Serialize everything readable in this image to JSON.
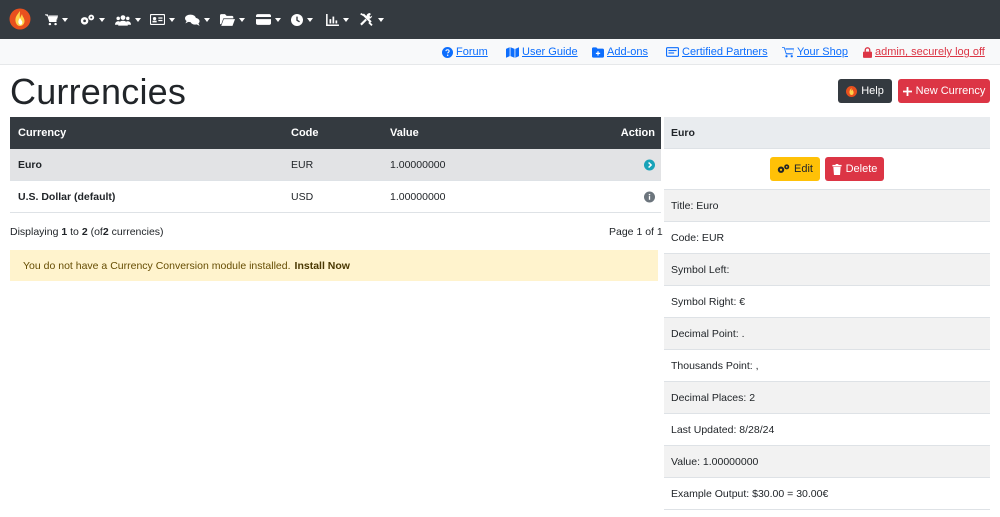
{
  "nav": {
    "icons": [
      "cart-icon",
      "gears-icon",
      "users-icon",
      "id-card-icon",
      "comments-icon",
      "folder-icon",
      "credit-card-icon",
      "clock-icon",
      "chart-icon",
      "tools-icon"
    ]
  },
  "links": {
    "forum": "Forum",
    "user_guide": "User Guide",
    "addons": "Add-ons",
    "partners": "Certified Partners",
    "shop": "Your Shop",
    "logoff": "admin, securely log off"
  },
  "page": {
    "title": "Currencies",
    "help_label": "Help",
    "new_label": "New Currency"
  },
  "table": {
    "headers": {
      "currency": "Currency",
      "code": "Code",
      "value": "Value",
      "action": "Action"
    },
    "rows": [
      {
        "currency": "Euro",
        "code": "EUR",
        "value": "1.00000000",
        "action": "arrow-right-icon"
      },
      {
        "currency": "U.S. Dollar (default)",
        "code": "USD",
        "value": "1.00000000",
        "action": "info-icon"
      }
    ]
  },
  "pagination": {
    "prefix": "Displaying",
    "from": "1",
    "to_word": "to",
    "to": "2",
    "of_open": "(of",
    "total": "2",
    "suffix": "currencies)",
    "page_info": "Page 1 of 1"
  },
  "alert": {
    "text": "You do not have a Currency Conversion module installed.",
    "link": "Install Now"
  },
  "panel": {
    "title": "Euro",
    "edit_label": "Edit",
    "delete_label": "Delete",
    "rows": [
      "Title: Euro",
      "Code: EUR",
      "Symbol Left:",
      "Symbol Right: €",
      "Decimal Point: .",
      "Thousands Point: ,",
      "Decimal Places: 2",
      "Last Updated: 8/28/24",
      "Value: 1.00000000",
      "Example Output: $30.00 = 30.00€"
    ]
  },
  "colors": {
    "navbar": "#343a40",
    "link": "#0d6efd",
    "danger": "#dc3545",
    "warning": "#ffc107",
    "alert_bg": "#fff3cd"
  }
}
